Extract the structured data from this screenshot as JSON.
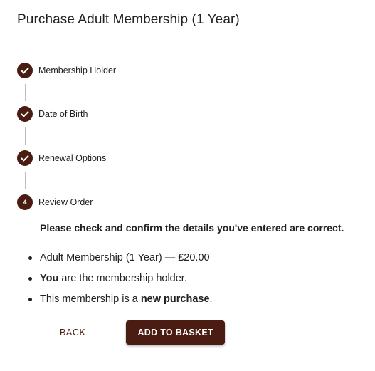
{
  "dialog": {
    "title": "Purchase Adult Membership (1 Year)"
  },
  "stepper": {
    "steps": [
      {
        "label": "Membership Holder",
        "state": "complete",
        "icon": "check-icon"
      },
      {
        "label": "Date of Birth",
        "state": "complete",
        "icon": "check-icon"
      },
      {
        "label": "Renewal Options",
        "state": "complete",
        "icon": "check-icon"
      },
      {
        "label": "Review Order",
        "state": "active",
        "number": "4"
      }
    ]
  },
  "review": {
    "confirm_text": "Please check and confirm the details you've entered are correct.",
    "items": [
      {
        "text": "Adult Membership (1 Year) — £20.00"
      },
      {
        "bold": "You",
        "text": " are the membership holder."
      },
      {
        "prefix": "This membership is a ",
        "bold": "new purchase",
        "suffix": "."
      }
    ]
  },
  "actions": {
    "back_label": "BACK",
    "add_label": "ADD TO BASKET"
  },
  "colors": {
    "accent": "#4a1c12",
    "connector": "#bdbdbd",
    "text": "#212121"
  }
}
